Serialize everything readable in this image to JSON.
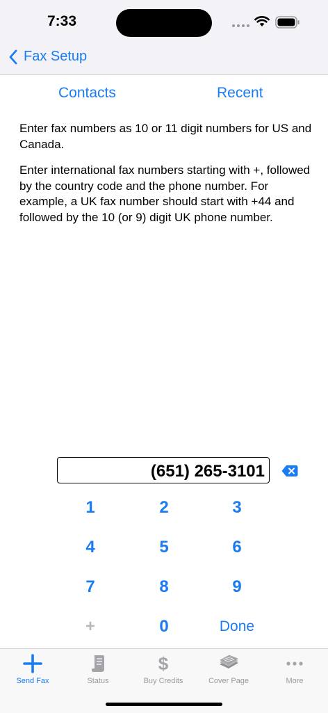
{
  "status_bar": {
    "time": "7:33"
  },
  "nav": {
    "back_label": "Fax Setup"
  },
  "segments": {
    "contacts": "Contacts",
    "recent": "Recent"
  },
  "instructions": {
    "p1": "Enter fax numbers as 10 or 11 digit numbers for US and Canada.",
    "p2": "Enter international fax numbers starting with +, followed by the country code and the phone number. For example, a UK fax number should start with +44 and followed by the 10 (or 9) digit UK phone number."
  },
  "fax_entry": {
    "value": "(651) 265-3101"
  },
  "keypad": {
    "k1": "1",
    "k2": "2",
    "k3": "3",
    "k4": "4",
    "k5": "5",
    "k6": "6",
    "k7": "7",
    "k8": "8",
    "k9": "9",
    "plus": "+",
    "k0": "0",
    "done": "Done"
  },
  "tabs": [
    {
      "label": "Send Fax",
      "icon": "plus-icon",
      "active": true
    },
    {
      "label": "Status",
      "icon": "scroll-icon",
      "active": false
    },
    {
      "label": "Buy Credits",
      "icon": "dollar-icon",
      "active": false
    },
    {
      "label": "Cover Page",
      "icon": "papers-icon",
      "active": false
    },
    {
      "label": "More",
      "icon": "more-dots-icon",
      "active": false
    }
  ],
  "colors": {
    "accent": "#1a7cf0",
    "inactive": "#9a9a9e"
  }
}
